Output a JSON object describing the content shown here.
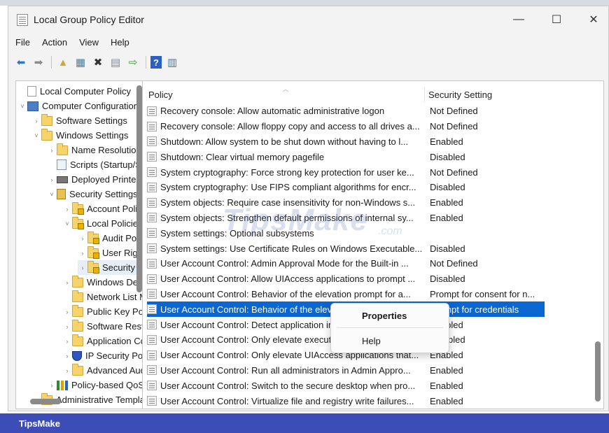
{
  "window": {
    "title": "Local Group Policy Editor",
    "minimize_glyph": "—",
    "maximize_glyph": "☐",
    "close_glyph": "✕"
  },
  "menu": [
    "File",
    "Action",
    "View",
    "Help"
  ],
  "toolbar": {
    "icons": [
      "back-arrow-icon",
      "forward-arrow-icon",
      "up-folder-icon",
      "show-hide-tree-icon",
      "delete-icon",
      "properties-icon",
      "export-list-icon",
      "help-icon",
      "filter-icon"
    ],
    "glyphs": {
      "back": "⬅",
      "forward": "➡",
      "up": "▲",
      "tree": "▦",
      "delete": "✖",
      "props": "▤",
      "export": "⇨",
      "help": "?",
      "filter": "▥"
    }
  },
  "tree": {
    "items": [
      {
        "label": "Local Computer Policy",
        "icon": "doc",
        "twisty": ""
      },
      {
        "label": "Computer Configuration",
        "icon": "computer",
        "twisty": "˅"
      },
      {
        "label": "Software Settings",
        "icon": "folder",
        "twisty": "›"
      },
      {
        "label": "Windows Settings",
        "icon": "folder",
        "twisty": "˅"
      },
      {
        "label": "Name Resolution Policy",
        "icon": "folder",
        "twisty": "›"
      },
      {
        "label": "Scripts (Startup/Shutdown)",
        "icon": "scripts",
        "twisty": ""
      },
      {
        "label": "Deployed Printers",
        "icon": "printer",
        "twisty": "›"
      },
      {
        "label": "Security Settings",
        "icon": "security",
        "twisty": "˅"
      },
      {
        "label": "Account Policies",
        "icon": "lockfolder",
        "twisty": "›"
      },
      {
        "label": "Local Policies",
        "icon": "lockfolder",
        "twisty": "˅"
      },
      {
        "label": "Audit Policy",
        "icon": "lockfolder",
        "twisty": "›"
      },
      {
        "label": "User Rights Assignment",
        "icon": "lockfolder",
        "twisty": "›"
      },
      {
        "label": "Security Options",
        "icon": "lockfolder",
        "twisty": "›"
      },
      {
        "label": "Windows Defender Firewall",
        "icon": "folder",
        "twisty": "›"
      },
      {
        "label": "Network List Manager Policies",
        "icon": "folder",
        "twisty": ""
      },
      {
        "label": "Public Key Policies",
        "icon": "folder",
        "twisty": "›"
      },
      {
        "label": "Software Restriction Policies",
        "icon": "folder",
        "twisty": "›"
      },
      {
        "label": "Application Control Policies",
        "icon": "folder",
        "twisty": "›"
      },
      {
        "label": "IP Security Policies",
        "icon": "shield",
        "twisty": "›"
      },
      {
        "label": "Advanced Audit Policy Configuration",
        "icon": "folder",
        "twisty": "›"
      },
      {
        "label": "Policy-based QoS",
        "icon": "bars",
        "twisty": "›"
      },
      {
        "label": "Administrative Templates",
        "icon": "folder",
        "twisty": "›"
      }
    ]
  },
  "list": {
    "columns": [
      "Policy",
      "Security Setting"
    ],
    "rows": [
      {
        "policy": "Recovery console: Allow automatic administrative logon",
        "setting": "Not Defined"
      },
      {
        "policy": "Recovery console: Allow floppy copy and access to all drives a...",
        "setting": "Not Defined"
      },
      {
        "policy": "Shutdown: Allow system to be shut down without having to l...",
        "setting": "Enabled"
      },
      {
        "policy": "Shutdown: Clear virtual memory pagefile",
        "setting": "Disabled"
      },
      {
        "policy": "System cryptography: Force strong key protection for user ke...",
        "setting": "Not Defined"
      },
      {
        "policy": "System cryptography: Use FIPS compliant algorithms for encr...",
        "setting": "Disabled"
      },
      {
        "policy": "System objects: Require case insensitivity for non-Windows s...",
        "setting": "Enabled"
      },
      {
        "policy": "System objects: Strengthen default permissions of internal sy...",
        "setting": "Enabled"
      },
      {
        "policy": "System settings: Optional subsystems",
        "setting": ""
      },
      {
        "policy": "System settings: Use Certificate Rules on Windows Executable...",
        "setting": "Disabled"
      },
      {
        "policy": "User Account Control: Admin Approval Mode for the Built-in ...",
        "setting": "Not Defined"
      },
      {
        "policy": "User Account Control: Allow UIAccess applications to prompt ...",
        "setting": "Disabled"
      },
      {
        "policy": "User Account Control: Behavior of the elevation prompt for a...",
        "setting": "Prompt for consent for n..."
      },
      {
        "policy": "User Account Control: Behavior of the elevation prompt for st...",
        "setting": "Prompt for credentials"
      },
      {
        "policy": "User Account Control: Detect application installations and pr...",
        "setting": "Enabled"
      },
      {
        "policy": "User Account Control: Only elevate executables that are sign...",
        "setting": "Disabled"
      },
      {
        "policy": "User Account Control: Only elevate UIAccess applications that...",
        "setting": "Enabled"
      },
      {
        "policy": "User Account Control: Run all administrators in Admin Appro...",
        "setting": "Enabled"
      },
      {
        "policy": "User Account Control: Switch to the secure desktop when pro...",
        "setting": "Enabled"
      },
      {
        "policy": "User Account Control: Virtualize file and registry write failures...",
        "setting": "Enabled"
      }
    ],
    "selected_index": 13
  },
  "context_menu": {
    "items": [
      "Properties",
      "Help"
    ]
  },
  "watermark": {
    "text": "TipsMake",
    "sub": ".com"
  },
  "footer": {
    "text": "TipsMake"
  }
}
